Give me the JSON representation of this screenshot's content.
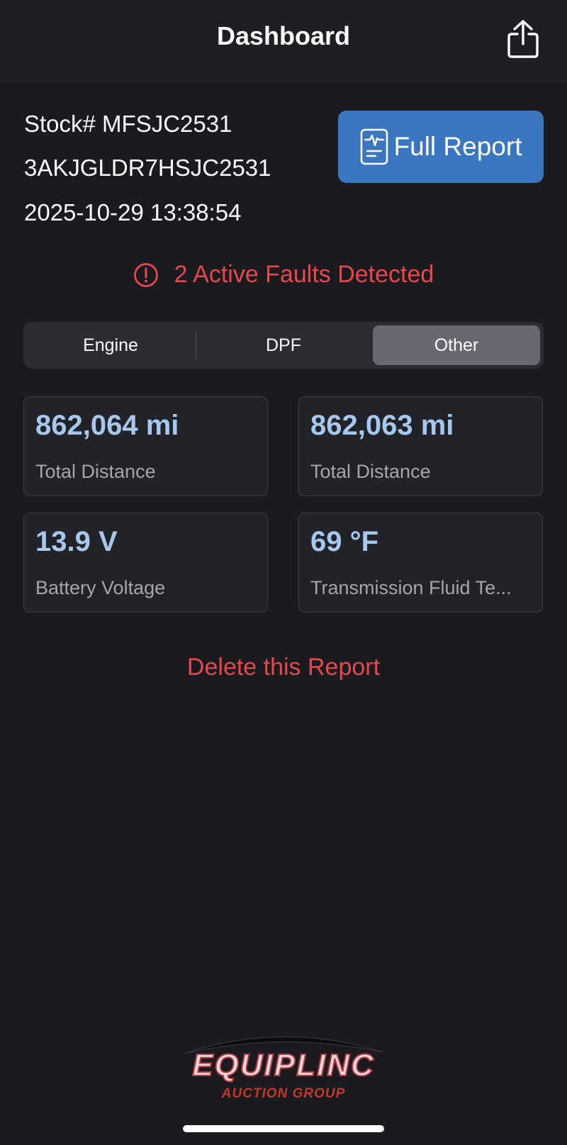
{
  "header": {
    "title": "Dashboard",
    "share_icon": "share-icon"
  },
  "vehicle": {
    "stock": "Stock# MFSJC2531",
    "vin": "3AKJGLDR7HSJC2531",
    "timestamp": "2025-10-29 13:38:54"
  },
  "full_report": {
    "label": "Full Report",
    "icon": "report-icon"
  },
  "faults": {
    "text": "2 Active Faults Detected",
    "icon": "alert-circle-icon",
    "color": "#e5484d"
  },
  "tabs": {
    "selected": "Other",
    "items": [
      {
        "label": "Engine"
      },
      {
        "label": "DPF"
      },
      {
        "label": "Other"
      }
    ]
  },
  "cards": [
    {
      "value": "862,064 mi",
      "label": "Total Distance"
    },
    {
      "value": "862,063 mi",
      "label": "Total Distance"
    },
    {
      "value": "13.9 V",
      "label": "Battery Voltage"
    },
    {
      "value": "69 °F",
      "label": "Transmission Fluid Te..."
    }
  ],
  "delete_label": "Delete this Report",
  "logo": {
    "brand": "EQUIPLINC",
    "sub": "AUCTION GROUP"
  },
  "colors": {
    "accent_blue": "#3a77c0",
    "value_blue": "#a6c8ec",
    "danger_red": "#e5484d",
    "background": "#1a1a1f"
  }
}
